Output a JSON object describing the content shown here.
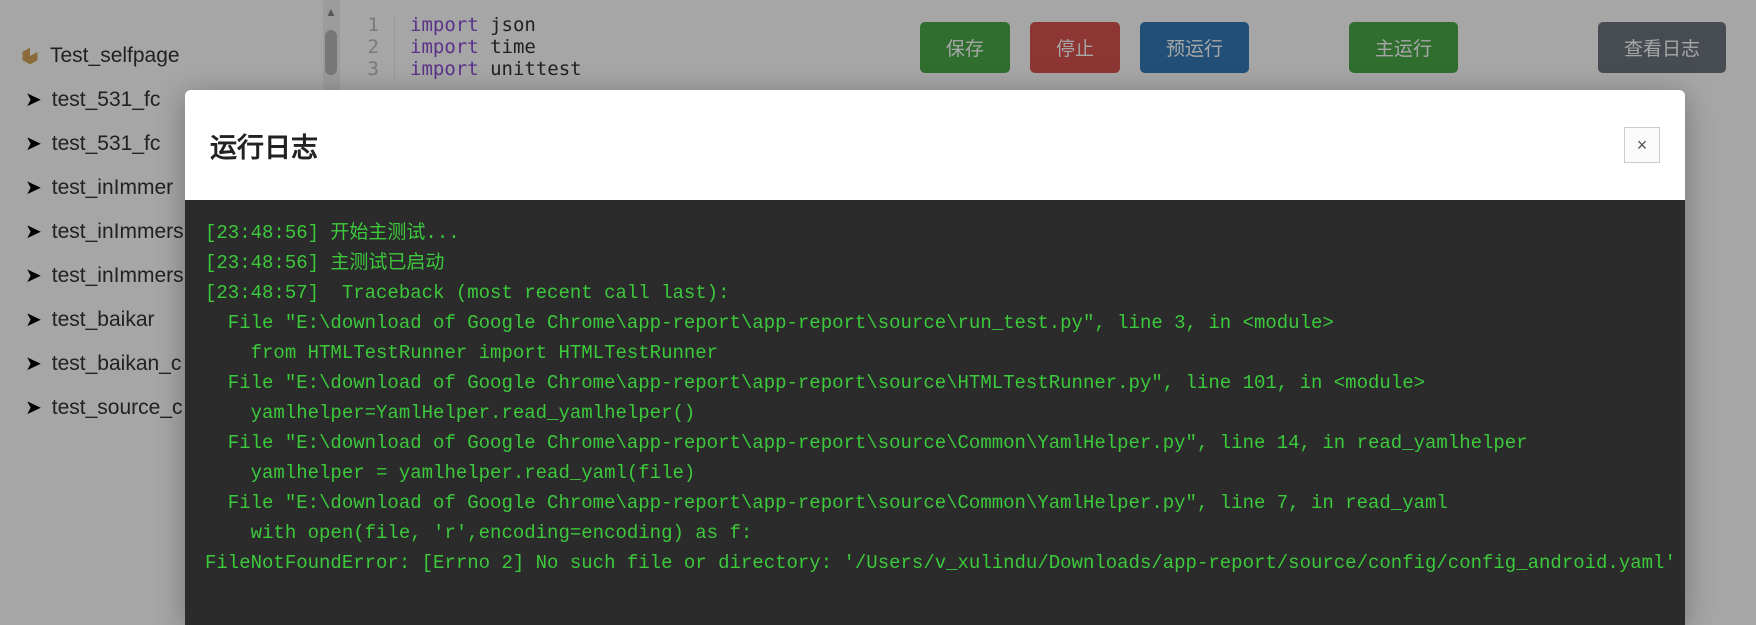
{
  "sidebar": {
    "header": "Test_selfpage",
    "items": [
      "test_531_fc",
      "test_531_fc",
      "test_inImmer",
      "test_inImmers",
      "test_inImmers",
      "test_baikar",
      "test_baikan_c",
      "test_source_c"
    ]
  },
  "toolbar": {
    "save": "保存",
    "stop": "停止",
    "pre_run": "预运行",
    "main_run": "主运行",
    "view_log": "查看日志"
  },
  "editor": {
    "lines": [
      {
        "n": "1",
        "kw": "import",
        "rest": " json"
      },
      {
        "n": "2",
        "kw": "import",
        "rest": " time"
      },
      {
        "n": "3",
        "kw": "import",
        "rest": " unittest"
      }
    ]
  },
  "modal": {
    "title": "运行日志",
    "close": "×",
    "log": [
      "[23:48:56] 开始主测试...",
      "[23:48:56] 主测试已启动",
      "[23:48:57]  Traceback (most recent call last):",
      "  File \"E:\\download of Google Chrome\\app-report\\app-report\\source\\run_test.py\", line 3, in <module>",
      "    from HTMLTestRunner import HTMLTestRunner",
      "  File \"E:\\download of Google Chrome\\app-report\\app-report\\source\\HTMLTestRunner.py\", line 101, in <module>",
      "    yamlhelper=YamlHelper.read_yamlhelper()",
      "  File \"E:\\download of Google Chrome\\app-report\\app-report\\source\\Common\\YamlHelper.py\", line 14, in read_yamlhelper",
      "    yamlhelper = yamlhelper.read_yaml(file)",
      "  File \"E:\\download of Google Chrome\\app-report\\app-report\\source\\Common\\YamlHelper.py\", line 7, in read_yaml",
      "    with open(file, 'r',encoding=encoding) as f:",
      "FileNotFoundError: [Errno 2] No such file or directory: '/Users/v_xulindu/Downloads/app-report/source/config/config_android.yaml'"
    ]
  }
}
